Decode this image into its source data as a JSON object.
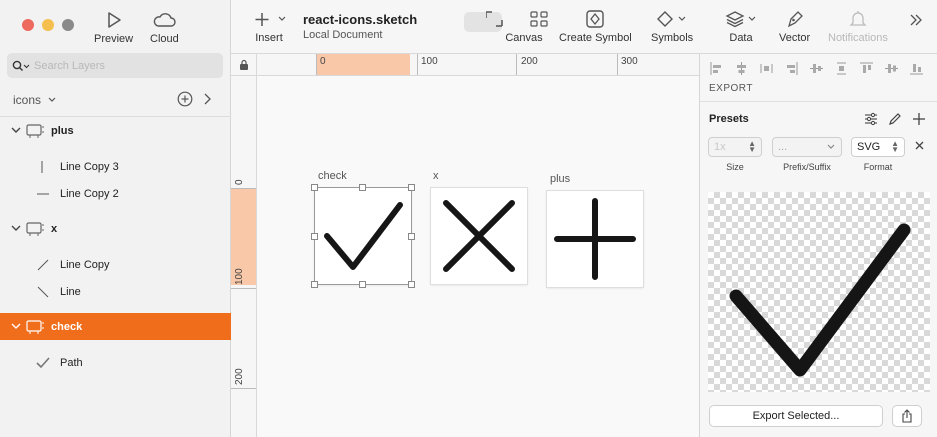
{
  "window": {
    "title": "react-icons.sketch",
    "subtitle": "Local Document"
  },
  "sidebar": {
    "preview_label": "Preview",
    "cloud_label": "Cloud",
    "search_placeholder": "Search Layers",
    "page_name": "icons",
    "layers": [
      {
        "type": "group",
        "name": "plus",
        "selected": false,
        "icon": "artboard-icon"
      },
      {
        "type": "child",
        "name": "Line Copy 3",
        "icon": "vertical-line-icon"
      },
      {
        "type": "child",
        "name": "Line Copy 2",
        "icon": "horizontal-line-icon"
      },
      {
        "type": "group",
        "name": "x",
        "selected": false,
        "icon": "artboard-icon"
      },
      {
        "type": "child",
        "name": "Line Copy",
        "icon": "diagonal-line-icon"
      },
      {
        "type": "child",
        "name": "Line",
        "icon": "diagonal-line-icon"
      },
      {
        "type": "group",
        "name": "check",
        "selected": true,
        "icon": "artboard-icon"
      },
      {
        "type": "child",
        "name": "Path",
        "icon": "path-icon"
      }
    ]
  },
  "toolbar": {
    "insert": "Insert",
    "canvas": "Canvas",
    "create_symbol": "Create Symbol",
    "symbols": "Symbols",
    "data": "Data",
    "vector": "Vector",
    "notifications": "Notifications"
  },
  "rulers": {
    "h_labels": [
      "0",
      "100",
      "200",
      "300"
    ],
    "v_labels": [
      "0",
      "100",
      "200"
    ]
  },
  "canvas": {
    "artboards": [
      {
        "name": "check",
        "selected": true
      },
      {
        "name": "x",
        "selected": false
      },
      {
        "name": "plus",
        "selected": false
      }
    ]
  },
  "inspector": {
    "export_header": "EXPORT",
    "presets_label": "Presets",
    "size_value": "1x",
    "prefix_value": "...",
    "format_value": "SVG",
    "size_label": "Size",
    "prefix_label": "Prefix/Suffix",
    "format_label": "Format",
    "export_button": "Export Selected..."
  },
  "colors": {
    "accent": "#f06d1b",
    "ruler_highlight": "#f8c8a8",
    "traffic_close": "#ee6a5f",
    "traffic_min": "#f5bf4f"
  }
}
